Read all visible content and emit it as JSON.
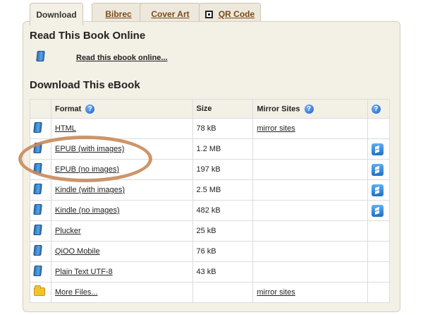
{
  "tabs": [
    {
      "label": "Download",
      "active": true
    },
    {
      "label": "Bibrec",
      "active": false
    },
    {
      "label": "Cover Art",
      "active": false
    },
    {
      "label": "QR Code",
      "active": false,
      "icon": "qr-code-icon"
    }
  ],
  "read_online": {
    "heading": "Read This Book Online",
    "link_label": "Read this ebook online...",
    "icon": "book-icon"
  },
  "download": {
    "heading": "Download This eBook",
    "columns": {
      "format": "Format",
      "size": "Size",
      "mirror": "Mirror Sites",
      "help": "?"
    },
    "rows": [
      {
        "format": "HTML",
        "size": "78 kB",
        "mirror": "mirror sites",
        "dropbox": false,
        "icon": "book-icon"
      },
      {
        "format": "EPUB (with images)",
        "size": "1.2 MB",
        "mirror": "",
        "dropbox": true,
        "icon": "book-icon"
      },
      {
        "format": "EPUB (no images)",
        "size": "197 kB",
        "mirror": "",
        "dropbox": true,
        "icon": "book-icon"
      },
      {
        "format": "Kindle (with images)",
        "size": "2.5 MB",
        "mirror": "",
        "dropbox": true,
        "icon": "book-icon"
      },
      {
        "format": "Kindle (no images)",
        "size": "482 kB",
        "mirror": "",
        "dropbox": true,
        "icon": "book-icon"
      },
      {
        "format": "Plucker",
        "size": "25 kB",
        "mirror": "",
        "dropbox": false,
        "icon": "book-icon"
      },
      {
        "format": "QiOO Mobile",
        "size": "76 kB",
        "mirror": "",
        "dropbox": false,
        "icon": "book-icon"
      },
      {
        "format": "Plain Text UTF-8",
        "size": "43 kB",
        "mirror": "",
        "dropbox": false,
        "icon": "book-icon"
      },
      {
        "format": "More Files...",
        "size": "",
        "mirror": "mirror sites",
        "dropbox": false,
        "icon": "folder-icon"
      }
    ]
  },
  "colors": {
    "panel": "#f3f0e6",
    "tab_link": "#7a4a1a",
    "annotation": "#c88a5a",
    "help_blue": "#1f5fbf"
  }
}
